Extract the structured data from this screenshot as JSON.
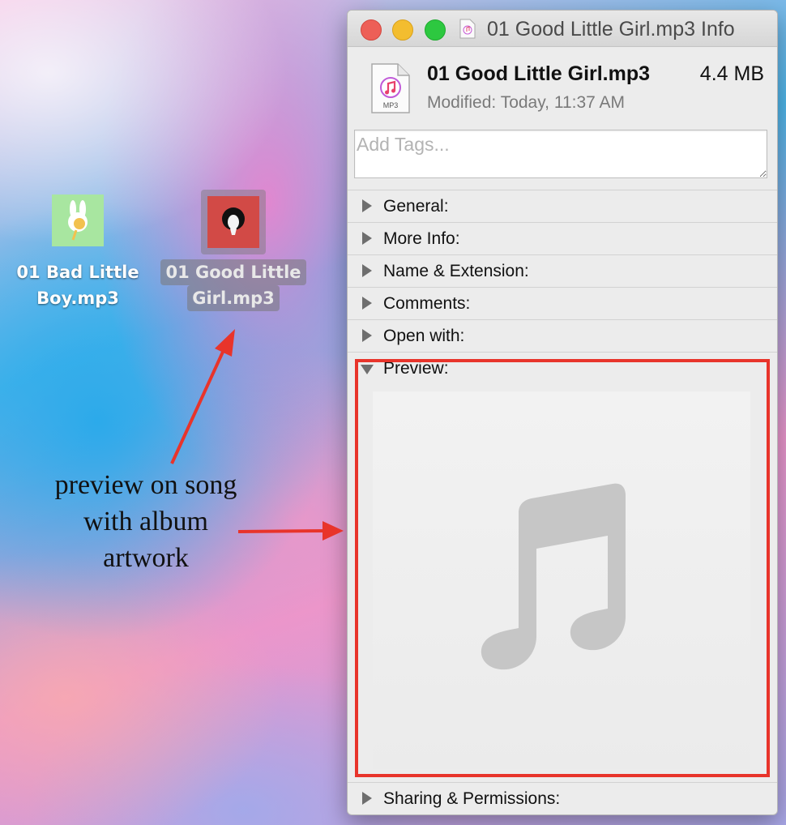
{
  "desktop": {
    "icons": [
      {
        "label_line1": "01 Bad Little",
        "label_line2": "Boy.mp3",
        "selected": false
      },
      {
        "label_line1": "01 Good Little",
        "label_line2": "Girl.mp3",
        "selected": true
      }
    ]
  },
  "annotation": {
    "text_line1": "preview on song",
    "text_line2": "with album",
    "text_line3": "artwork",
    "color": "#e8342b"
  },
  "window": {
    "title": "01 Good Little Girl.mp3 Info",
    "file_name": "01 Good Little Girl.mp3",
    "file_size": "4.4 MB",
    "modified_label": "Modified:",
    "modified_value": "Today, 11:37 AM",
    "file_icon_badge": "MP3",
    "tags_placeholder": "Add Tags...",
    "sections": [
      {
        "label": "General:",
        "expanded": false
      },
      {
        "label": "More Info:",
        "expanded": false
      },
      {
        "label": "Name & Extension:",
        "expanded": false
      },
      {
        "label": "Comments:",
        "expanded": false
      },
      {
        "label": "Open with:",
        "expanded": false
      },
      {
        "label": "Preview:",
        "expanded": true
      }
    ],
    "footer_section": {
      "label": "Sharing & Permissions:",
      "expanded": false
    },
    "preview_icon": "music-note-icon"
  }
}
